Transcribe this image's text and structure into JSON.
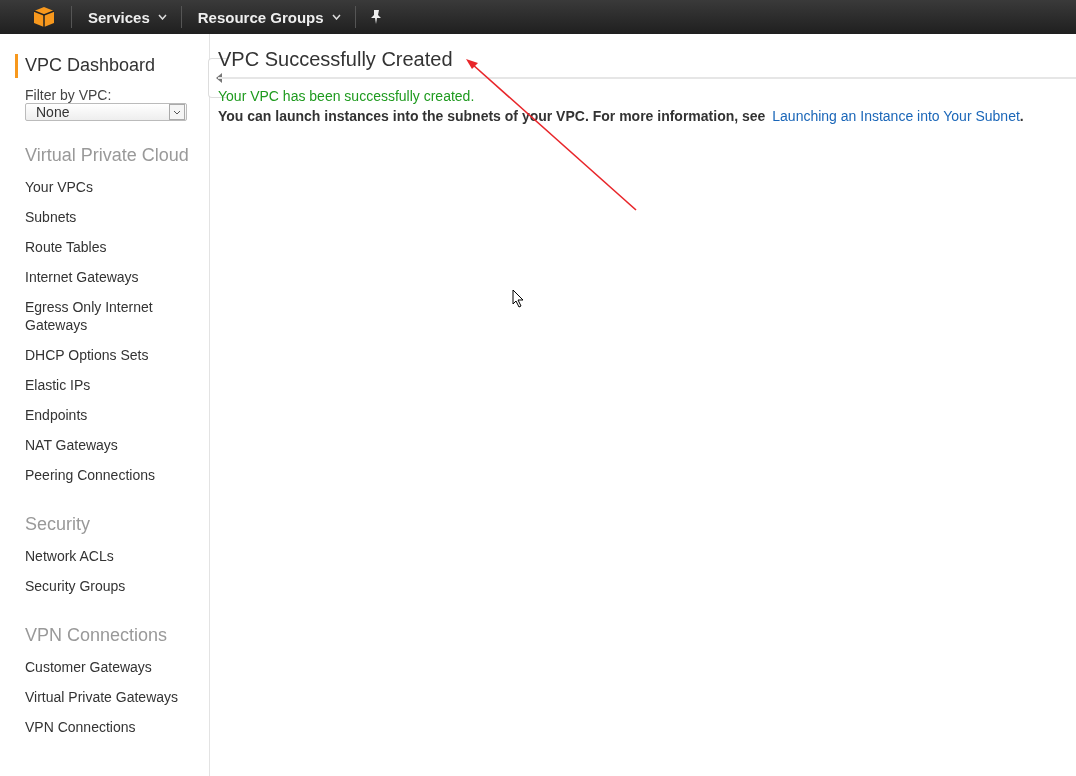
{
  "topbar": {
    "menus": [
      {
        "label": "Services"
      },
      {
        "label": "Resource Groups"
      }
    ]
  },
  "sidebar": {
    "dashboard": {
      "label": "VPC Dashboard",
      "selected": true
    },
    "filter": {
      "label": "Filter by VPC:",
      "value": "None"
    },
    "sections": [
      {
        "title": "Virtual Private Cloud",
        "items": [
          {
            "label": "Your VPCs",
            "selected": false
          },
          {
            "label": "Subnets",
            "selected": false
          },
          {
            "label": "Route Tables",
            "selected": false
          },
          {
            "label": "Internet Gateways",
            "selected": false
          },
          {
            "label": "Egress Only Internet Gateways",
            "selected": false
          },
          {
            "label": "DHCP Options Sets",
            "selected": false
          },
          {
            "label": "Elastic IPs",
            "selected": false
          },
          {
            "label": "Endpoints",
            "selected": false
          },
          {
            "label": "NAT Gateways",
            "selected": false
          },
          {
            "label": "Peering Connections",
            "selected": false
          }
        ]
      },
      {
        "title": "Security",
        "items": [
          {
            "label": "Network ACLs",
            "selected": false
          },
          {
            "label": "Security Groups",
            "selected": false
          }
        ]
      },
      {
        "title": "VPN Connections",
        "items": [
          {
            "label": "Customer Gateways",
            "selected": false
          },
          {
            "label": "Virtual Private Gateways",
            "selected": false
          },
          {
            "label": "VPN Connections",
            "selected": false
          }
        ]
      }
    ]
  },
  "main": {
    "title": "VPC Successfully Created",
    "success": "Your VPC has been successfully created.",
    "info": {
      "text": "You can launch instances into the subnets of your VPC. For more information, see",
      "link": "Launching an Instance into Your Subnet",
      "suffix": "."
    }
  }
}
